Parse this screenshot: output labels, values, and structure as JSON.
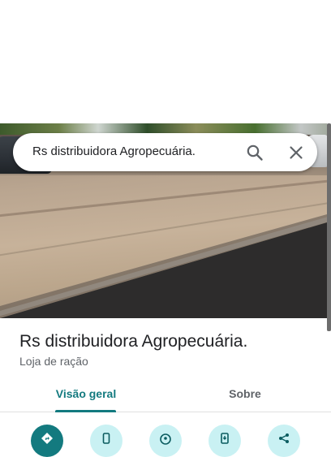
{
  "search": {
    "query": "Rs distribuidora Agropecuária."
  },
  "place": {
    "title": "Rs distribuidora Agropecuária.",
    "category": "Loja de ração"
  },
  "tabs": [
    {
      "label": "Visão geral",
      "active": true
    },
    {
      "label": "Sobre",
      "active": false
    }
  ],
  "actions": [
    {
      "icon": "directions-icon"
    },
    {
      "icon": "phone-icon"
    },
    {
      "icon": "nearby-icon"
    },
    {
      "icon": "save-to-phone-icon"
    },
    {
      "icon": "share-icon"
    }
  ],
  "colors": {
    "accent": "#137a7f",
    "action_bg": "#c9f1f3",
    "title": "#202124",
    "muted": "#5f6368"
  }
}
